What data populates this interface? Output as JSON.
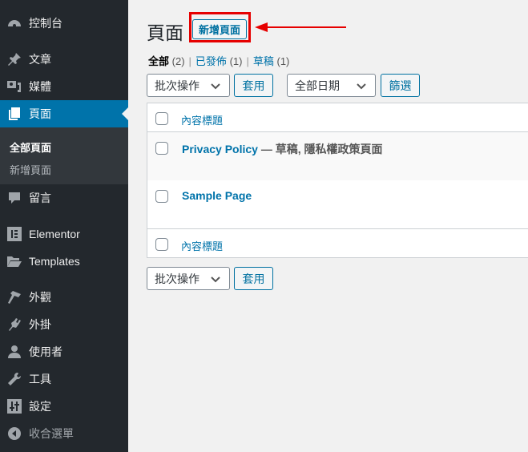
{
  "sidebar": {
    "items": [
      {
        "label": "控制台",
        "icon": "dashboard-icon"
      },
      {
        "label": "文章",
        "icon": "pin-icon"
      },
      {
        "label": "媒體",
        "icon": "media-icon"
      },
      {
        "label": "頁面",
        "icon": "pages-icon"
      },
      {
        "label": "留言",
        "icon": "comment-icon"
      },
      {
        "label": "Elementor",
        "icon": "elementor-icon"
      },
      {
        "label": "Templates",
        "icon": "folder-icon"
      },
      {
        "label": "外觀",
        "icon": "paintbrush-icon"
      },
      {
        "label": "外掛",
        "icon": "plugin-icon"
      },
      {
        "label": "使用者",
        "icon": "user-icon"
      },
      {
        "label": "工具",
        "icon": "wrench-icon"
      },
      {
        "label": "設定",
        "icon": "settings-icon"
      },
      {
        "label": "收合選單",
        "icon": "collapse-icon"
      }
    ],
    "submenu": [
      "全部頁面",
      "新增頁面"
    ]
  },
  "main": {
    "title": "頁面",
    "add_new": "新增頁面",
    "filters": [
      {
        "label": "全部",
        "count": "(2)"
      },
      {
        "label": "已發佈",
        "count": "(1)"
      },
      {
        "label": "草稿",
        "count": "(1)"
      }
    ],
    "bulk_action": "批次操作",
    "apply": "套用",
    "date_filter": "全部日期",
    "filter_btn": "篩選",
    "column_title": "內容標題",
    "rows": [
      {
        "title": "Privacy Policy",
        "state": " — 草稿, 隱私權政策頁面"
      },
      {
        "title": "Sample Page",
        "state": ""
      }
    ]
  },
  "colors": {
    "sidebar": "#23282d",
    "active": "#0073aa",
    "highlight": "#e60000"
  }
}
